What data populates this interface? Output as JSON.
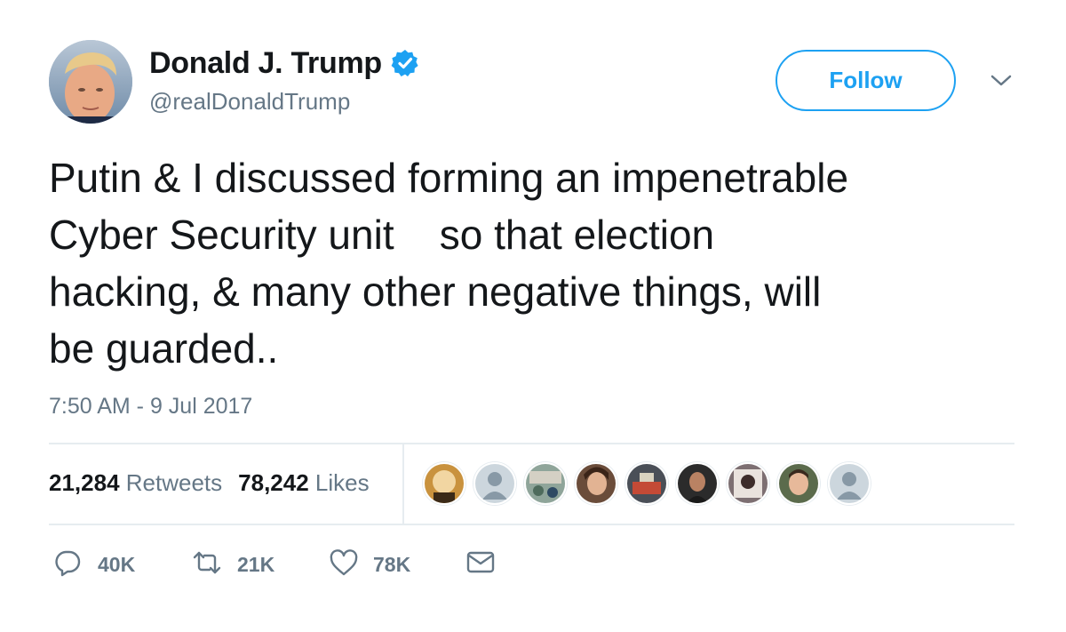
{
  "author": {
    "display_name": "Donald J. Trump",
    "handle": "@realDonaldTrump",
    "verified": true
  },
  "follow_label": "Follow",
  "tweet": {
    "text": "Putin & I discussed forming an impenetrable\nCyber Security unit    so that election\nhacking, & many other negative things, will\nbe guarded..",
    "timestamp": "7:50 AM - 9 Jul 2017"
  },
  "stats": {
    "retweets_count": "21,284",
    "retweets_label": "Retweets",
    "likes_count": "78,242",
    "likes_label": "Likes"
  },
  "actions": {
    "reply_count": "40K",
    "retweet_count": "21K",
    "like_count": "78K"
  },
  "icons": [
    "verified-badge-icon",
    "chevron-down-icon",
    "reply-icon",
    "retweet-icon",
    "heart-icon",
    "direct-message-icon"
  ],
  "colors": {
    "accent": "#1da1f2",
    "text": "#14171a",
    "secondary": "#657786",
    "divider": "#e6ecf0"
  }
}
